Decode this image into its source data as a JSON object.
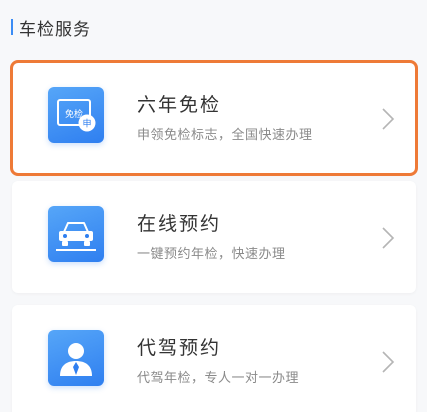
{
  "section": {
    "title": "车检服务"
  },
  "services": [
    {
      "title": "六年免检",
      "subtitle": "申领免检标志，全国快速办理",
      "icon": "exemption-sticker-icon"
    },
    {
      "title": "在线预约",
      "subtitle": "一键预约年检，快速办理",
      "icon": "car-icon"
    },
    {
      "title": "代驾预约",
      "subtitle": "代驾年检，专人一对一办理",
      "icon": "person-icon"
    }
  ],
  "colors": {
    "accent": "#3b8cf5",
    "highlight_border": "#ee7a37",
    "title_text": "#333333",
    "subtitle_text": "#8a8a8a"
  },
  "icon_text": {
    "sticker_label": "免检",
    "stamp": "申"
  }
}
